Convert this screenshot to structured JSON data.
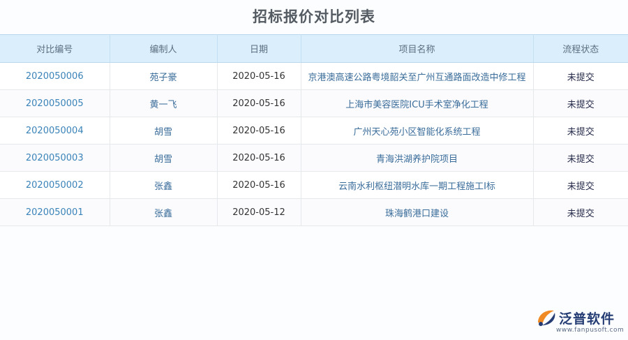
{
  "page_title": "招标报价对比列表",
  "table": {
    "columns": [
      "对比编号",
      "编制人",
      "日期",
      "项目名称",
      "流程状态"
    ],
    "rows": [
      {
        "code": "2020050006",
        "person": "苑子豪",
        "date": "2020-05-16",
        "project": "京港澳高速公路粤境韶关至广州互通路面改造中修工程",
        "status": "未提交"
      },
      {
        "code": "2020050005",
        "person": "黄一飞",
        "date": "2020-05-16",
        "project": "上海市美容医院ICU手术室净化工程",
        "status": "未提交"
      },
      {
        "code": "2020050004",
        "person": "胡雪",
        "date": "2020-05-16",
        "project": "广州天心苑小区智能化系统工程",
        "status": "未提交"
      },
      {
        "code": "2020050003",
        "person": "胡雪",
        "date": "2020-05-16",
        "project": "青海洪湖养护院项目",
        "status": "未提交"
      },
      {
        "code": "2020050002",
        "person": "张鑫",
        "date": "2020-05-16",
        "project": "云南水利枢纽潜明水库一期工程施工I标",
        "status": "未提交"
      },
      {
        "code": "2020050001",
        "person": "张鑫",
        "date": "2020-05-12",
        "project": "珠海鹤港口建设",
        "status": "未提交"
      }
    ]
  },
  "watermark": {
    "brand": "泛普软件",
    "url": "www.fanpusoft.com",
    "colors": {
      "orange": "#f08a24",
      "navy": "#253d74"
    }
  }
}
